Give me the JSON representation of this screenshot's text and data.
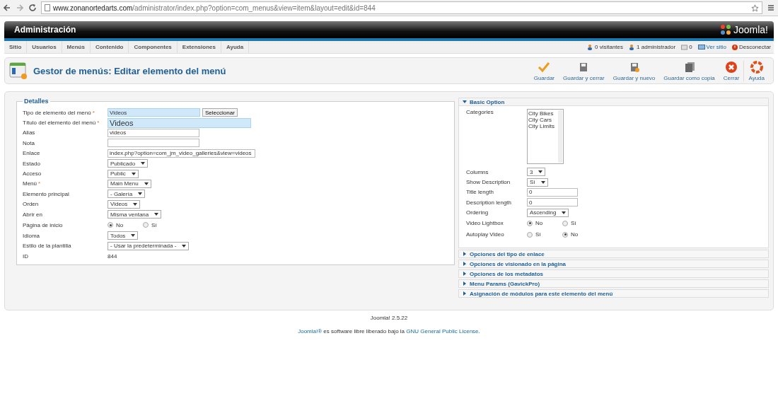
{
  "browser": {
    "url_host": "www.zonanortedarts.com",
    "url_path": "/administrator/index.php?option=com_menus&view=item&layout=edit&id=844"
  },
  "header": {
    "title": "Administración",
    "logo_text": "Joomla!"
  },
  "menu": [
    "Sitio",
    "Usuarios",
    "Menús",
    "Contenido",
    "Componentes",
    "Extensiones",
    "Ayuda"
  ],
  "status": [
    {
      "kind": "visitors",
      "text": "0 visitantes"
    },
    {
      "kind": "admins",
      "text": "1 administrador"
    },
    {
      "kind": "messages",
      "text": "0"
    },
    {
      "kind": "view-site",
      "text": "Ver sitio"
    },
    {
      "kind": "logout",
      "text": "Desconectar"
    }
  ],
  "page_title": "Gestor de menús: Editar elemento del menú",
  "toolbar": [
    {
      "kind": "save",
      "label": "Guardar"
    },
    {
      "kind": "save-close",
      "label": "Guardar y cerrar"
    },
    {
      "kind": "save-new",
      "label": "Guardar y nuevo"
    },
    {
      "kind": "save-copy",
      "label": "Guardar como copia"
    },
    {
      "kind": "close",
      "label": "Cerrar"
    },
    {
      "kind": "help",
      "label": "Ayuda"
    }
  ],
  "details": {
    "legend": "Detalles",
    "fields": [
      {
        "kind": "type",
        "label": "Tipo de elemento del menú",
        "required_mark": "*",
        "value": "Videos",
        "button": "Seleccionar"
      },
      {
        "kind": "title",
        "label": "Título del elemento del menú",
        "required_mark": "*",
        "value": "Videos"
      },
      {
        "kind": "text",
        "label": "Alias",
        "value": "videos"
      },
      {
        "kind": "text",
        "label": "Nota"
      },
      {
        "kind": "link",
        "label": "Enlace",
        "value": "index.php?option=com_jm_video_galleries&view=videos"
      },
      {
        "kind": "select",
        "label": "Estado",
        "value": "Publicado"
      },
      {
        "kind": "select",
        "label": "Acceso",
        "value": "Public"
      },
      {
        "kind": "select",
        "label": "Menú",
        "required_mark": "*",
        "value": "Main Menu"
      },
      {
        "kind": "select",
        "label": "Elemento principal",
        "value": "- Galería"
      },
      {
        "kind": "select",
        "label": "Orden",
        "value": "Videos"
      },
      {
        "kind": "select",
        "label": "Abrir en",
        "value": "Misma ventana"
      },
      {
        "kind": "radio",
        "label": "Página de inicio",
        "options": [
          {
            "label": "No",
            "selected": true
          },
          {
            "label": "Sí",
            "selected": false
          }
        ]
      },
      {
        "kind": "select",
        "label": "Idioma",
        "value": "Todos"
      },
      {
        "kind": "select",
        "label": "Estilo de la plantilla",
        "value": "- Usar la predeterminada -"
      },
      {
        "kind": "static",
        "label": "ID",
        "value": "844"
      }
    ]
  },
  "basic": {
    "title": "Basic Option",
    "expanded": true,
    "fields": [
      {
        "kind": "listbox",
        "label": "Categories",
        "options": [
          "City Bikes",
          "City Cars",
          "City Limits"
        ]
      },
      {
        "kind": "select",
        "label": "Columns",
        "value": "3"
      },
      {
        "kind": "select",
        "label": "Show Description",
        "value": "Sí"
      },
      {
        "kind": "text",
        "label": "Title length",
        "value": "0"
      },
      {
        "kind": "text",
        "label": "Description length",
        "value": "0"
      },
      {
        "kind": "select",
        "label": "Ordering",
        "value": "Ascending"
      },
      {
        "kind": "radio",
        "label": "Video Lightbox",
        "options": [
          {
            "label": "No",
            "selected": true
          },
          {
            "label": "Sí",
            "selected": false
          }
        ]
      },
      {
        "kind": "radio",
        "label": "Autoplay Video",
        "options": [
          {
            "label": "Sí",
            "selected": false
          },
          {
            "label": "No",
            "selected": true
          }
        ]
      }
    ]
  },
  "sections": [
    {
      "title": "Opciones del tipo de enlace",
      "expanded": false
    },
    {
      "title": "Opciones de visionado en la página",
      "expanded": false
    },
    {
      "title": "Opciones de los metadatos",
      "expanded": false
    },
    {
      "title": "Menu Params (GavickPro)",
      "expanded": false
    },
    {
      "title": "Asignación de módulos para este elemento del menú",
      "expanded": false
    }
  ],
  "footer": {
    "version": "Joomla! 2.5.22",
    "license_link": "Joomla!®",
    "license_text": " es software libre liberado bajo la ",
    "gpl_link": "GNU General Public License",
    "end": "."
  }
}
